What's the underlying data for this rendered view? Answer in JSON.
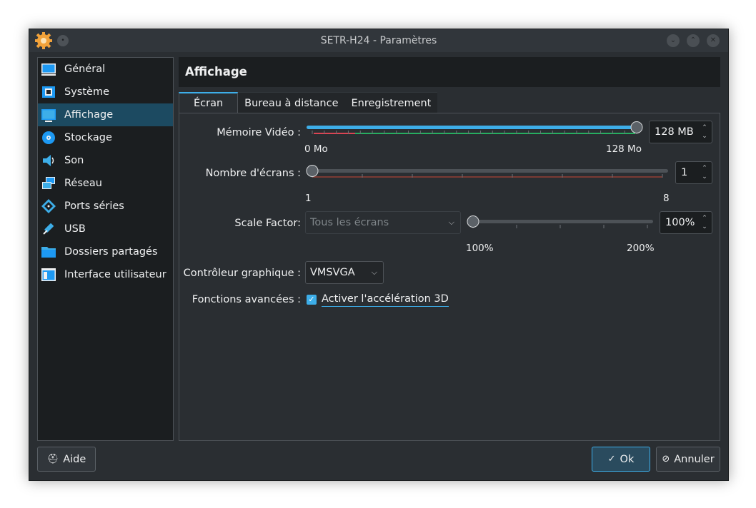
{
  "window": {
    "title": "SETR-H24 - Paramètres"
  },
  "sidebar": {
    "items": [
      {
        "label": "Général",
        "icon": "monitor-general-icon",
        "active": false
      },
      {
        "label": "Système",
        "icon": "chip-icon",
        "active": false
      },
      {
        "label": "Affichage",
        "icon": "display-icon",
        "active": true
      },
      {
        "label": "Stockage",
        "icon": "disk-icon",
        "active": false
      },
      {
        "label": "Son",
        "icon": "speaker-icon",
        "active": false
      },
      {
        "label": "Réseau",
        "icon": "network-icon",
        "active": false
      },
      {
        "label": "Ports séries",
        "icon": "serial-port-icon",
        "active": false
      },
      {
        "label": "USB",
        "icon": "usb-icon",
        "active": false
      },
      {
        "label": "Dossiers partagés",
        "icon": "folder-icon",
        "active": false
      },
      {
        "label": "Interface utilisateur",
        "icon": "window-ui-icon",
        "active": false
      }
    ]
  },
  "page": {
    "title": "Affichage"
  },
  "tabs": [
    {
      "label": "Écran",
      "active": true
    },
    {
      "label": "Bureau à distance",
      "active": false
    },
    {
      "label": "Enregistrement",
      "active": false
    }
  ],
  "screen": {
    "video_memory": {
      "label": "Mémoire Vidéo :",
      "value": "128 MB",
      "min_label": "0 Mo",
      "max_label": "128 Mo",
      "level": 1.0
    },
    "monitors": {
      "label": "Nombre d'écrans :",
      "value": "1",
      "min_label": "1",
      "max_label": "8",
      "level": 0.0
    },
    "scale": {
      "label": "Scale Factor:",
      "combo_value": "Tous les écrans",
      "value": "100%",
      "min_label": "100%",
      "max_label": "200%",
      "level": 0.0
    },
    "controller": {
      "label": "Contrôleur graphique :",
      "value": "VMSVGA"
    },
    "advanced": {
      "label": "Fonctions avancées :",
      "checkbox_label": "Activer l'accélération 3D",
      "checked": true
    }
  },
  "footer": {
    "help_label": "Aide",
    "ok_label": "Ok",
    "cancel_label": "Annuler"
  },
  "colors": {
    "accent": "#3daee9",
    "background": "#2a2e32",
    "active_item": "#1c4a61"
  }
}
